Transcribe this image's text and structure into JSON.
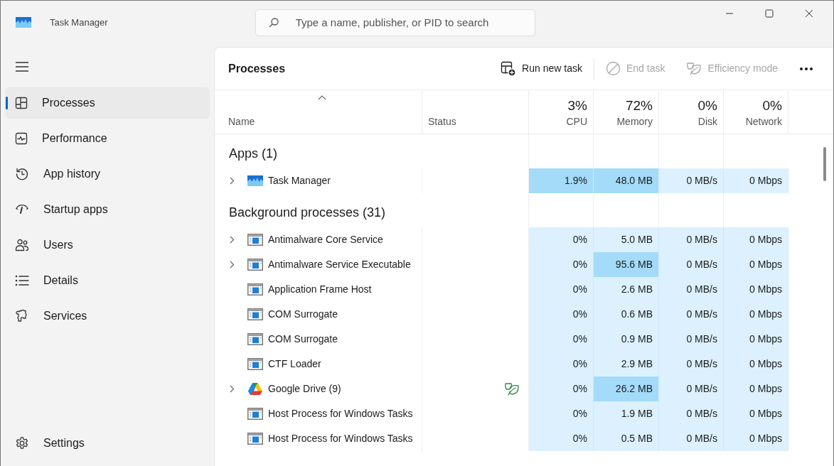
{
  "window": {
    "title": "Task Manager"
  },
  "search": {
    "placeholder": "Type a name, publisher, or PID to search"
  },
  "sidebar": {
    "items": [
      {
        "label": "Processes",
        "selected": true
      },
      {
        "label": "Performance",
        "selected": false
      },
      {
        "label": "App history",
        "selected": false
      },
      {
        "label": "Startup apps",
        "selected": false
      },
      {
        "label": "Users",
        "selected": false
      },
      {
        "label": "Details",
        "selected": false
      },
      {
        "label": "Services",
        "selected": false
      }
    ],
    "footer": {
      "label": "Settings"
    }
  },
  "page_title": "Processes",
  "toolbar": [
    {
      "label": "Run new task",
      "disabled": false
    },
    {
      "label": "End task",
      "disabled": true
    },
    {
      "label": "Efficiency mode",
      "disabled": true
    }
  ],
  "columns": [
    {
      "label": "Name",
      "sorted": true
    },
    {
      "label": "Status",
      "sorted": false
    },
    {
      "label": "CPU",
      "total": "3%",
      "sorted": false
    },
    {
      "label": "Memory",
      "total": "72%",
      "sorted": false
    },
    {
      "label": "Disk",
      "total": "0%",
      "sorted": false
    },
    {
      "label": "Network",
      "total": "0%",
      "sorted": false
    }
  ],
  "groups": [
    {
      "title": "Apps (1)",
      "rows": [
        {
          "name": "Task Manager",
          "kind": "app",
          "expandable": true,
          "efficiency": false,
          "cells": [
            {
              "text": "1.9%",
              "color": "#a4dbf9"
            },
            {
              "text": "48.0 MB",
              "color": "#a4dbf9"
            },
            {
              "text": "0 MB/s",
              "color": "#dcf1fd"
            },
            {
              "text": "0 Mbps",
              "color": "#dcf1fd"
            }
          ]
        }
      ]
    },
    {
      "title": "Background processes (31)",
      "rows": [
        {
          "name": "Antimalware Core Service",
          "kind": "service",
          "expandable": true,
          "efficiency": false,
          "cells": [
            {
              "text": "0%",
              "color": "#dcf1fd"
            },
            {
              "text": "5.0 MB",
              "color": "#dcf1fd"
            },
            {
              "text": "0 MB/s",
              "color": "#dcf1fd"
            },
            {
              "text": "0 Mbps",
              "color": "#dcf1fd"
            }
          ]
        },
        {
          "name": "Antimalware Service Executable",
          "kind": "service",
          "expandable": true,
          "efficiency": false,
          "cells": [
            {
              "text": "0%",
              "color": "#dcf1fd"
            },
            {
              "text": "95.6 MB",
              "color": "#a4dbf9"
            },
            {
              "text": "0 MB/s",
              "color": "#dcf1fd"
            },
            {
              "text": "0 Mbps",
              "color": "#dcf1fd"
            }
          ]
        },
        {
          "name": "Application Frame Host",
          "kind": "service",
          "expandable": false,
          "efficiency": false,
          "cells": [
            {
              "text": "0%",
              "color": "#dcf1fd"
            },
            {
              "text": "2.6 MB",
              "color": "#dcf1fd"
            },
            {
              "text": "0 MB/s",
              "color": "#dcf1fd"
            },
            {
              "text": "0 Mbps",
              "color": "#dcf1fd"
            }
          ]
        },
        {
          "name": "COM Surrogate",
          "kind": "service",
          "expandable": false,
          "efficiency": false,
          "cells": [
            {
              "text": "0%",
              "color": "#dcf1fd"
            },
            {
              "text": "0.6 MB",
              "color": "#dcf1fd"
            },
            {
              "text": "0 MB/s",
              "color": "#dcf1fd"
            },
            {
              "text": "0 Mbps",
              "color": "#dcf1fd"
            }
          ]
        },
        {
          "name": "COM Surrogate",
          "kind": "service",
          "expandable": false,
          "efficiency": false,
          "cells": [
            {
              "text": "0%",
              "color": "#dcf1fd"
            },
            {
              "text": "0.9 MB",
              "color": "#dcf1fd"
            },
            {
              "text": "0 MB/s",
              "color": "#dcf1fd"
            },
            {
              "text": "0 Mbps",
              "color": "#dcf1fd"
            }
          ]
        },
        {
          "name": "CTF Loader",
          "kind": "service",
          "expandable": false,
          "efficiency": false,
          "cells": [
            {
              "text": "0%",
              "color": "#dcf1fd"
            },
            {
              "text": "2.9 MB",
              "color": "#dcf1fd"
            },
            {
              "text": "0 MB/s",
              "color": "#dcf1fd"
            },
            {
              "text": "0 Mbps",
              "color": "#dcf1fd"
            }
          ]
        },
        {
          "name": "Google Drive (9)",
          "kind": "drive",
          "expandable": true,
          "efficiency": true,
          "cells": [
            {
              "text": "0%",
              "color": "#dcf1fd"
            },
            {
              "text": "26.2 MB",
              "color": "#a4dbf9"
            },
            {
              "text": "0 MB/s",
              "color": "#dcf1fd"
            },
            {
              "text": "0 Mbps",
              "color": "#dcf1fd"
            }
          ]
        },
        {
          "name": "Host Process for Windows Tasks",
          "kind": "service",
          "expandable": false,
          "efficiency": false,
          "cells": [
            {
              "text": "0%",
              "color": "#dcf1fd"
            },
            {
              "text": "1.9 MB",
              "color": "#dcf1fd"
            },
            {
              "text": "0 MB/s",
              "color": "#dcf1fd"
            },
            {
              "text": "0 Mbps",
              "color": "#dcf1fd"
            }
          ]
        },
        {
          "name": "Host Process for Windows Tasks",
          "kind": "service",
          "expandable": false,
          "efficiency": false,
          "cells": [
            {
              "text": "0%",
              "color": "#dcf1fd"
            },
            {
              "text": "0.5 MB",
              "color": "#dcf1fd"
            },
            {
              "text": "0 MB/s",
              "color": "#dcf1fd"
            },
            {
              "text": "0 Mbps",
              "color": "#dcf1fd"
            }
          ]
        }
      ]
    }
  ]
}
